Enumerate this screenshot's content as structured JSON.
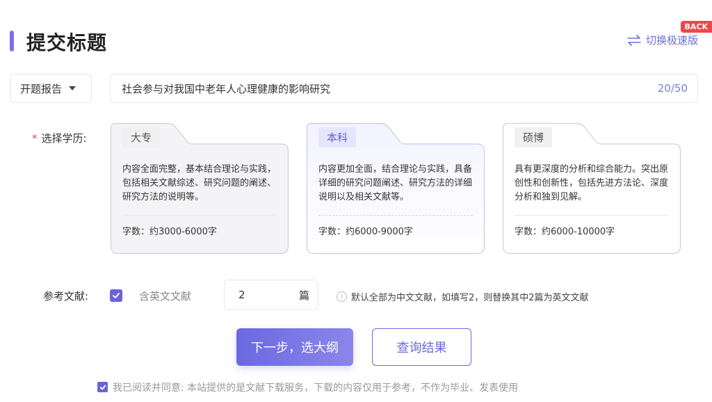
{
  "header": {
    "title": "提交标题",
    "switch_label": "切换极速版",
    "back_badge": "BACK"
  },
  "title_row": {
    "type_select": "开题报告",
    "title_value": "社会参与对我国中老年人心理健康的影响研究",
    "char_count": "20/50"
  },
  "education": {
    "required_mark": "*",
    "label": "选择学历:",
    "selected": "本科",
    "cards": [
      {
        "tag": "大专",
        "description": "内容全面完整，基本结合理论与实践，包括相关文献综述、研究问题的阐述、研究方法的说明等。",
        "word_count": "字数：约3000-6000字"
      },
      {
        "tag": "本科",
        "description": "内容更加全面，结合理论与实践，具备详细的研究问题阐述、研究方法的详细说明以及相关文献等。",
        "word_count": "字数：约6000-9000字"
      },
      {
        "tag": "硕博",
        "description": "具有更深度的分析和综合能力。突出原创性和创新性，包括先进方法论、深度分析和独到见解。",
        "word_count": "字数：约6000-10000字"
      }
    ]
  },
  "references": {
    "label": "参考文献:",
    "include_english_label": "含英文文献",
    "include_english_checked": true,
    "count_value": "2",
    "count_unit": "篇",
    "hint": "默认全部为中文文献，如填写2，则替换其中2篇为英文文献"
  },
  "actions": {
    "next_label": "下一步，选大纲",
    "query_label": "查询结果"
  },
  "agreement": {
    "checked": true,
    "text": "我已阅读并同意: 本站提供的是文献下载服务，下载的内容仅用于参考，不作为毕业、发表使用"
  },
  "colors": {
    "accent": "#6c68e0",
    "badge": "#f0464d",
    "required": "#f0464d"
  },
  "icons": {
    "switch": "swap-arrows-icon",
    "select_caret": "caret-down-icon",
    "check": "check-icon",
    "info": "info-icon"
  }
}
